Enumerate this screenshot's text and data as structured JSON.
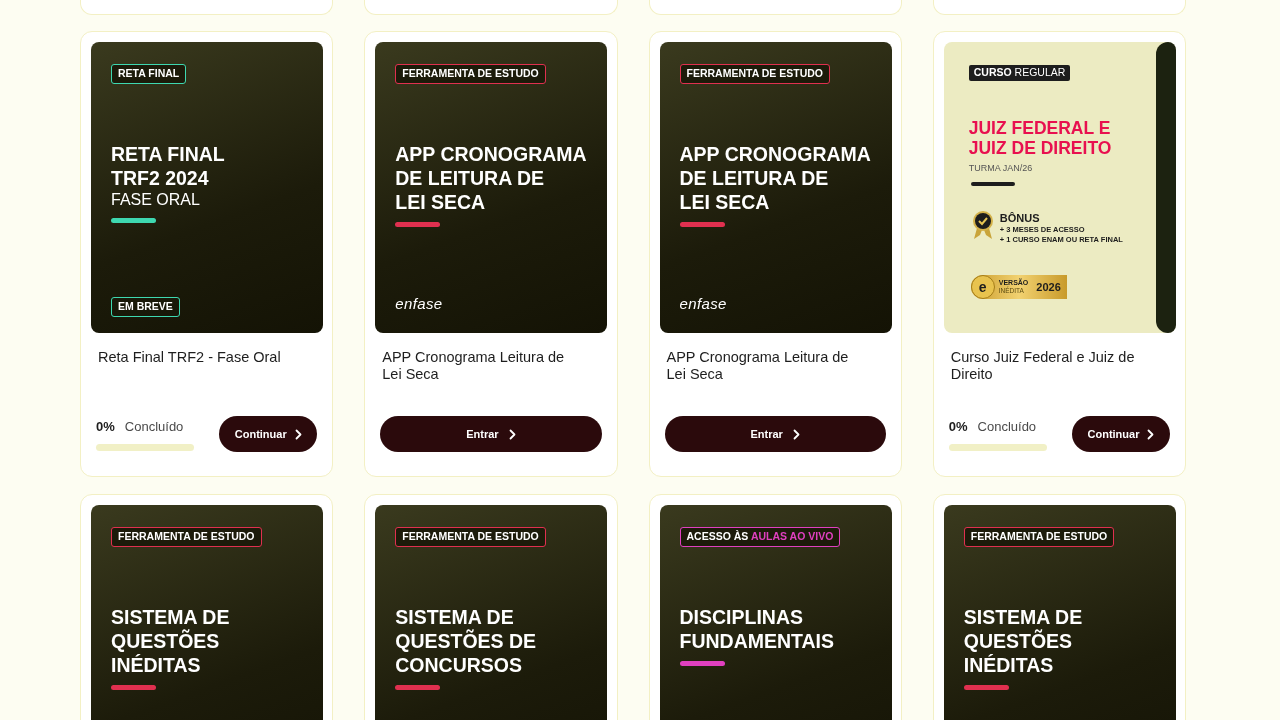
{
  "partial_cards": [
    {
      "kind": "cut"
    },
    {
      "kind": "cut"
    },
    {
      "kind": "cut"
    },
    {
      "kind": "cut"
    }
  ],
  "cards": [
    {
      "banner": {
        "kind": "photo",
        "tag": [
          {
            "text": "RETA FINAL",
            "highlight": false
          }
        ],
        "color": "#3ed8b0",
        "headline": [
          "RETA FINAL",
          "TRF2 2024"
        ],
        "subtitle": "FASE ORAL",
        "bottom_tag": "EM BREVE"
      },
      "title": "Reta Final TRF2 - Fase Oral",
      "footer": {
        "kind": "progress",
        "percent": "0%",
        "label": "Concluído",
        "level": 0,
        "button": "Continuar"
      }
    },
    {
      "banner": {
        "kind": "photo",
        "tag": [
          {
            "text": "FERRAMENTA DE ESTUDO",
            "highlight": false
          }
        ],
        "color": "#e0304f",
        "headline": [
          "APP CRONOGRAMA",
          "DE LEITURA DE",
          "LEI SECA"
        ],
        "logo": "enfase"
      },
      "title": "APP Cronograma Leitura de Lei Seca",
      "footer": {
        "kind": "button",
        "button": "Entrar"
      }
    },
    {
      "banner": {
        "kind": "photo",
        "tag": [
          {
            "text": "FERRAMENTA DE ESTUDO",
            "highlight": false
          }
        ],
        "color": "#e0304f",
        "headline": [
          "APP CRONOGRAMA",
          "DE LEITURA DE",
          "LEI SECA"
        ],
        "logo": "enfase"
      },
      "title": "APP Cronograma Leitura de Lei Seca",
      "footer": {
        "kind": "button",
        "button": "Entrar"
      }
    },
    {
      "banner": {
        "kind": "poster",
        "tag": "**CURSO** REGULAR",
        "headline": [
          "JUIZ FEDERAL E",
          "JUIZ DE DIREITO"
        ],
        "subtitle": "TURMA JAN/26",
        "bonus_title": "BÔNUS",
        "bonus_items": [
          "+ 3 MESES DE ACESSO",
          "+ 1 CURSO ENAM OU RETA FINAL"
        ],
        "seal": {
          "mark": "e",
          "label_top": "VERSÃO",
          "label_bottom": "INÉDITA",
          "year": "2026"
        }
      },
      "title": "Curso Juiz Federal e Juiz de Direito",
      "footer": {
        "kind": "progress",
        "percent": "0%",
        "label": "Concluído",
        "level": 0,
        "button": "Continuar"
      }
    },
    {
      "banner": {
        "kind": "photo",
        "tag": [
          {
            "text": "FERRAMENTA DE ESTUDO",
            "highlight": false
          }
        ],
        "color": "#e0304f",
        "headline": [
          "SISTEMA DE",
          "QUESTÕES",
          "INÉDITAS"
        ]
      }
    },
    {
      "banner": {
        "kind": "photo",
        "tag": [
          {
            "text": "FERRAMENTA DE ESTUDO",
            "highlight": false
          }
        ],
        "color": "#e0304f",
        "headline": [
          "SISTEMA DE",
          "QUESTÕES DE",
          "CONCURSOS"
        ]
      }
    },
    {
      "banner": {
        "kind": "photo",
        "tag": [
          {
            "text": "ACESSO ÀS",
            "highlight": false
          },
          {
            "text": "AULAS AO VIVO",
            "highlight": true
          }
        ],
        "color": "#e040c0",
        "headline": [
          "DISCIPLINAS",
          "FUNDAMENTAIS"
        ]
      }
    },
    {
      "banner": {
        "kind": "photo",
        "tag": [
          {
            "text": "FERRAMENTA DE ESTUDO",
            "highlight": false
          }
        ],
        "color": "#e0304f",
        "headline": [
          "SISTEMA DE",
          "QUESTÕES",
          "INÉDITAS"
        ]
      }
    }
  ]
}
